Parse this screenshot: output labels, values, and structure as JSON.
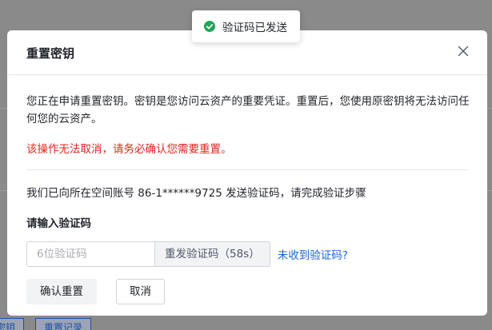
{
  "toast": {
    "message": "验证码已发送",
    "icon": "check-circle-icon",
    "color": "#23a55a"
  },
  "dialog": {
    "title": "重置密钥",
    "close_icon": "close-icon",
    "description": "您正在申请重置密钥。密钥是您访问云资产的重要凭证。重置后，您使用原密钥将无法访问任何您的云资产。",
    "warning": "该操作无法取消，请务必确认您需要重置。",
    "info": "我们已向所在空间账号 86-1******9725 发送验证码，请完成验证步骤",
    "code_label": "请输入验证码",
    "code_input": {
      "value": "",
      "placeholder": "6位验证码"
    },
    "resend_label": "重发验证码（58s）",
    "no_code_link": "未收到验证码?",
    "confirm_label": "确认重置",
    "cancel_label": "取消"
  },
  "background": {
    "buttons": [
      "密钥",
      "重置记录"
    ]
  },
  "colors": {
    "warning": "#e0281d",
    "link": "#1a64d6",
    "success": "#23a55a"
  }
}
